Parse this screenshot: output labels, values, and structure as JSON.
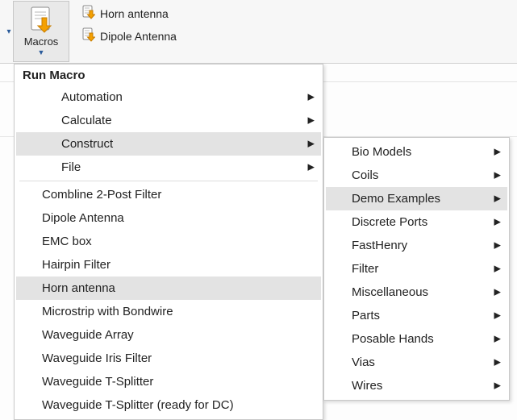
{
  "toolbar": {
    "macros_label": "Macros",
    "quick_items": [
      {
        "label": "Horn antenna"
      },
      {
        "label": "Dipole Antenna"
      }
    ]
  },
  "menu1": {
    "title": "Run Macro",
    "top_items": [
      {
        "label": "Automation",
        "has_submenu": true,
        "hover": false
      },
      {
        "label": "Calculate",
        "has_submenu": true,
        "hover": false
      },
      {
        "label": "Construct",
        "has_submenu": true,
        "hover": true
      },
      {
        "label": "File",
        "has_submenu": true,
        "hover": false
      }
    ],
    "bottom_items": [
      {
        "label": "Combline 2-Post Filter",
        "hover": false
      },
      {
        "label": "Dipole Antenna",
        "hover": false
      },
      {
        "label": "EMC box",
        "hover": false
      },
      {
        "label": "Hairpin Filter",
        "hover": false
      },
      {
        "label": "Horn antenna",
        "hover": true
      },
      {
        "label": "Microstrip with Bondwire",
        "hover": false
      },
      {
        "label": "Waveguide Array",
        "hover": false
      },
      {
        "label": "Waveguide Iris Filter",
        "hover": false
      },
      {
        "label": "Waveguide T-Splitter",
        "hover": false
      },
      {
        "label": "Waveguide T-Splitter (ready for DC)",
        "hover": false
      }
    ]
  },
  "menu2": {
    "items": [
      {
        "label": "Bio Models",
        "has_submenu": true,
        "hover": false
      },
      {
        "label": "Coils",
        "has_submenu": true,
        "hover": false
      },
      {
        "label": "Demo Examples",
        "has_submenu": true,
        "hover": true
      },
      {
        "label": "Discrete Ports",
        "has_submenu": true,
        "hover": false
      },
      {
        "label": "FastHenry",
        "has_submenu": true,
        "hover": false
      },
      {
        "label": "Filter",
        "has_submenu": true,
        "hover": false
      },
      {
        "label": "Miscellaneous",
        "has_submenu": true,
        "hover": false
      },
      {
        "label": "Parts",
        "has_submenu": true,
        "hover": false
      },
      {
        "label": "Posable Hands",
        "has_submenu": true,
        "hover": false
      },
      {
        "label": "Vias",
        "has_submenu": true,
        "hover": false
      },
      {
        "label": "Wires",
        "has_submenu": true,
        "hover": false
      }
    ]
  }
}
